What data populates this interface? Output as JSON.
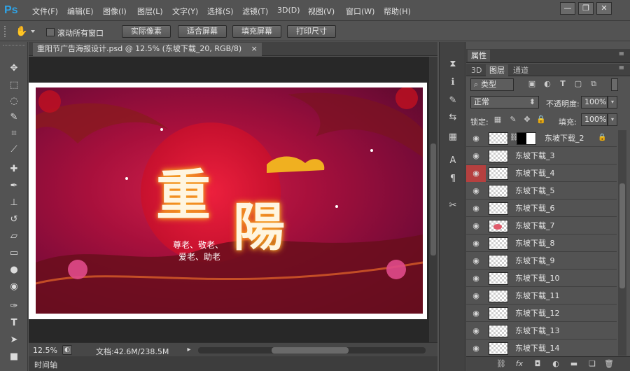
{
  "app": {
    "logo": "Ps"
  },
  "menu": [
    "文件(F)",
    "编辑(E)",
    "图像(I)",
    "图层(L)",
    "文字(Y)",
    "选择(S)",
    "滤镜(T)",
    "3D(D)",
    "视图(V)",
    "窗口(W)",
    "帮助(H)"
  ],
  "window_controls": {
    "minimize": "—",
    "restore": "❐",
    "close": "✕"
  },
  "options": {
    "scroll_all_label": "滚动所有窗口",
    "buttons": [
      "实际像素",
      "适合屏幕",
      "填充屏幕",
      "打印尺寸"
    ]
  },
  "document": {
    "tab_title": "重阳节广告海报设计.psd @ 12.5% (东坡下载_20, RGB/8)",
    "tab_close": "×",
    "zoom": "12.5%",
    "doc_size": "文档:42.6M/238.5M"
  },
  "artwork": {
    "title_char_1": "重",
    "title_char_2": "陽",
    "slogan_line_1": "尊老、敬老、",
    "slogan_line_2": "爱老、助老"
  },
  "timeline_label": "时间轴",
  "panel": {
    "properties_tab": "属性",
    "tabs": [
      "3D",
      "图层",
      "通道"
    ],
    "filter_kind": "类型",
    "blend_mode": "正常",
    "opacity_label": "不透明度:",
    "opacity_value": "100%",
    "lock_label": "锁定:",
    "fill_label": "填充:",
    "fill_value": "100%"
  },
  "layers": [
    {
      "name": "东坡下载_2",
      "selected": false,
      "eye_red": false
    },
    {
      "name": "东坡下载_3",
      "selected": false,
      "eye_red": false
    },
    {
      "name": "东坡下载_4",
      "selected": false,
      "eye_red": true
    },
    {
      "name": "东坡下载_5",
      "selected": false,
      "eye_red": false
    },
    {
      "name": "东坡下载_6",
      "selected": false,
      "eye_red": false
    },
    {
      "name": "东坡下载_7",
      "selected": false,
      "eye_red": false
    },
    {
      "name": "东坡下载_8",
      "selected": false,
      "eye_red": false
    },
    {
      "name": "东坡下载_9",
      "selected": false,
      "eye_red": false
    },
    {
      "name": "东坡下载_10",
      "selected": false,
      "eye_red": false
    },
    {
      "name": "东坡下载_11",
      "selected": false,
      "eye_red": false
    },
    {
      "name": "东坡下载_12",
      "selected": false,
      "eye_red": false
    },
    {
      "name": "东坡下载_13",
      "selected": false,
      "eye_red": false
    },
    {
      "name": "东坡下载_14",
      "selected": false,
      "eye_red": false
    }
  ],
  "colors": {
    "accent_ps": "#2fa3e6",
    "poster_bg": "#a8103c",
    "eye_highlight": "#b5403f"
  }
}
